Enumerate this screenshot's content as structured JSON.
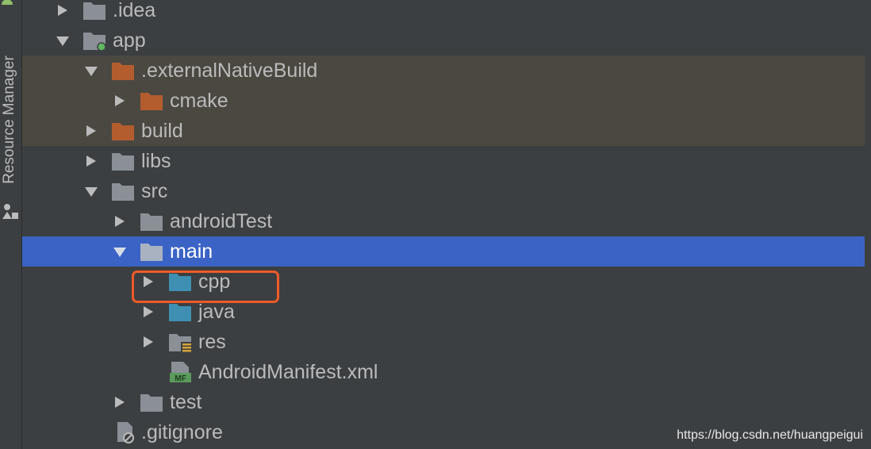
{
  "side_panel": {
    "tab_label": "Resource Manager"
  },
  "tree": {
    "rows": [
      {
        "label": ".idea"
      },
      {
        "label": "app"
      },
      {
        "label": ".externalNativeBuild"
      },
      {
        "label": "cmake"
      },
      {
        "label": "build"
      },
      {
        "label": "libs"
      },
      {
        "label": "src"
      },
      {
        "label": "androidTest"
      },
      {
        "label": "main"
      },
      {
        "label": "cpp"
      },
      {
        "label": "java"
      },
      {
        "label": "res"
      },
      {
        "label": "AndroidManifest.xml"
      },
      {
        "label": "test"
      },
      {
        "label": ".gitignore"
      }
    ],
    "selected": "main",
    "highlighted": "cpp"
  },
  "manifest_badge": "MF",
  "watermark": "https://blog.csdn.net/huangpeigui",
  "colors": {
    "background": "#3c3f41",
    "selection": "#3a63c5",
    "excluded_row": "#4b4841",
    "folder_gray": "#8a9096",
    "folder_excluded": "#b35d2f",
    "folder_source": "#3f8fb3",
    "highlight_box": "#ef5a28",
    "text": "#bbbbbb"
  }
}
